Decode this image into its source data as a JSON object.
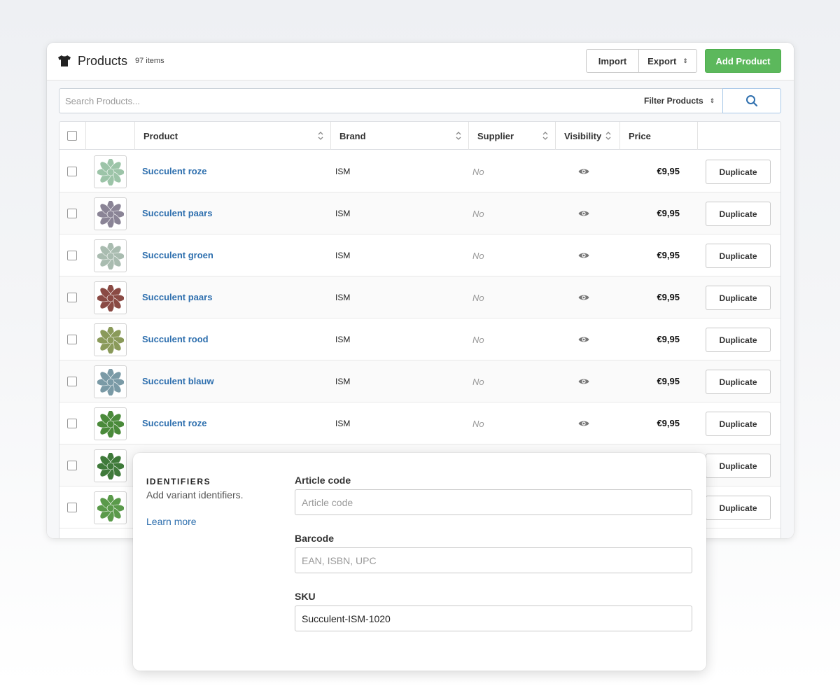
{
  "header": {
    "title": "Products",
    "count": "97 items",
    "import_label": "Import",
    "export_label": "Export",
    "add_label": "Add Product"
  },
  "search": {
    "placeholder": "Search Products...",
    "filter_label": "Filter Products"
  },
  "table": {
    "columns": [
      "Product",
      "Brand",
      "Supplier",
      "Visibility",
      "Price"
    ],
    "rows": [
      {
        "name": "Succulent roze",
        "brand": "ISM",
        "supplier": "No",
        "price": "€9,95",
        "action": "Duplicate",
        "thumb_color": "#9cc4a8"
      },
      {
        "name": "Succulent paars",
        "brand": "ISM",
        "supplier": "No",
        "price": "€9,95",
        "action": "Duplicate",
        "thumb_color": "#8a8496"
      },
      {
        "name": "Succulent groen",
        "brand": "ISM",
        "supplier": "No",
        "price": "€9,95",
        "action": "Duplicate",
        "thumb_color": "#a9bcb0"
      },
      {
        "name": "Succulent paars",
        "brand": "ISM",
        "supplier": "No",
        "price": "€9,95",
        "action": "Duplicate",
        "thumb_color": "#8a4a44"
      },
      {
        "name": "Succulent rood",
        "brand": "ISM",
        "supplier": "No",
        "price": "€9,95",
        "action": "Duplicate",
        "thumb_color": "#8a9a5a"
      },
      {
        "name": "Succulent blauw",
        "brand": "ISM",
        "supplier": "No",
        "price": "€9,95",
        "action": "Duplicate",
        "thumb_color": "#7a9aa6"
      },
      {
        "name": "Succulent roze",
        "brand": "ISM",
        "supplier": "No",
        "price": "€9,95",
        "action": "Duplicate",
        "thumb_color": "#4a8a3a"
      },
      {
        "name": "",
        "brand": "",
        "supplier": "",
        "price": "",
        "action": "Duplicate",
        "thumb_color": "#3f7a3a"
      },
      {
        "name": "",
        "brand": "",
        "supplier": "",
        "price": "",
        "action": "Duplicate",
        "thumb_color": "#5a9a4a"
      }
    ]
  },
  "identifiers": {
    "heading": "IDENTIFIERS",
    "subtitle": "Add variant identifiers.",
    "link": "Learn more",
    "article_label": "Article code",
    "article_placeholder": "Article code",
    "barcode_label": "Barcode",
    "barcode_placeholder": "EAN, ISBN, UPC",
    "sku_label": "SKU",
    "sku_value": "Succulent-ISM-1020"
  },
  "colors": {
    "accent_green": "#5cb85c",
    "link_blue": "#2e6fae"
  }
}
